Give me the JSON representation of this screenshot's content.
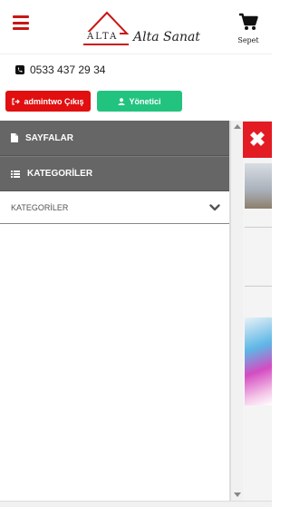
{
  "header": {
    "logo_text": "ALTA",
    "logo_script": "Alta Sanat",
    "cart_label": "Sepet"
  },
  "contact": {
    "phone": "0533 437 29 34"
  },
  "buttons": {
    "logout_label": "admintwo Çıkış",
    "admin_label": "Yönetici"
  },
  "side_menu": {
    "pages_label": "SAYFALAR",
    "categories_label": "KATEGORİLER",
    "categories_dropdown_label": "KATEGORİLER"
  },
  "colors": {
    "brand_red": "#c81616",
    "logout_red": "#e10f0f",
    "admin_green": "#22c37f",
    "menu_gray": "#666666",
    "close_red": "#e31b23"
  }
}
